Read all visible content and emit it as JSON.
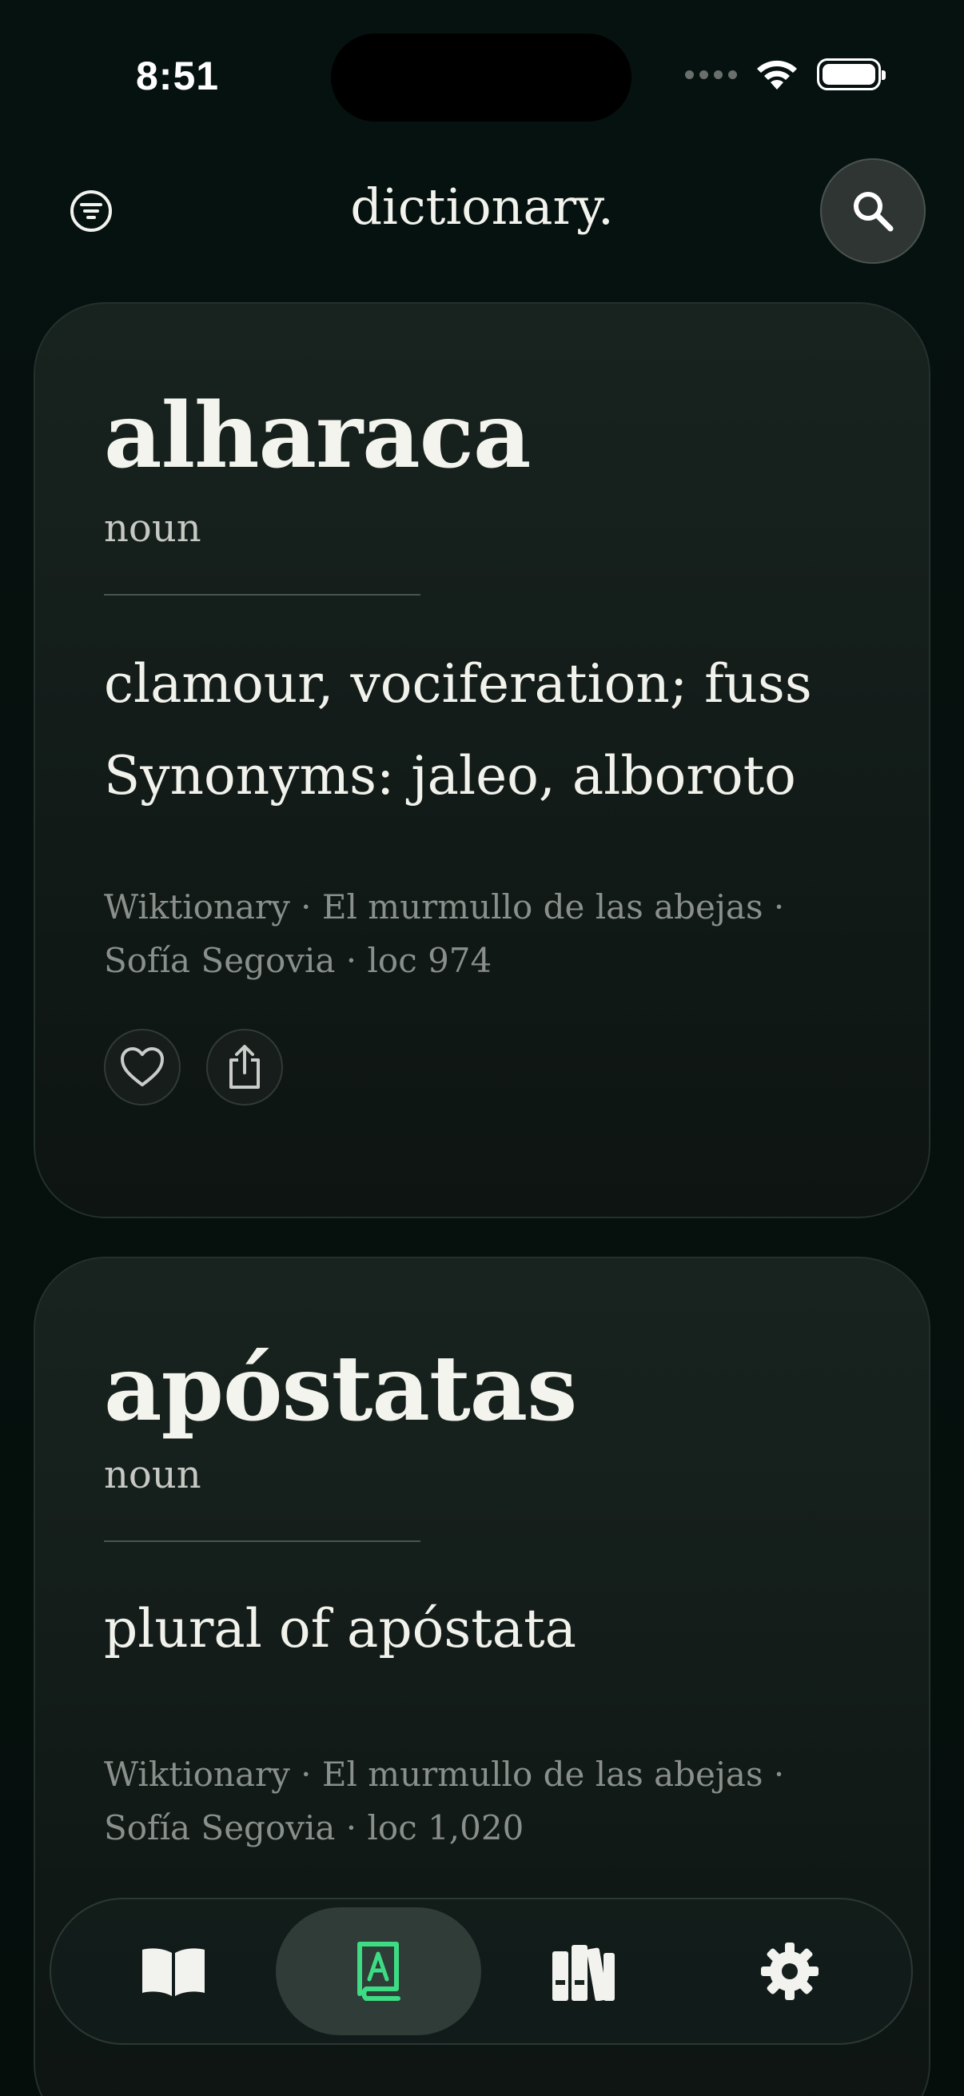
{
  "status_bar": {
    "time": "8:51"
  },
  "header": {
    "title": "dictionary."
  },
  "entries": [
    {
      "word": "alharaca",
      "part_of_speech": "noun",
      "definition": "clamour, vociferation; fuss",
      "synonyms": "Synonyms: jaleo, alboroto",
      "source": "Wiktionary · El murmullo de las abejas · Sofía Segovia · loc 974"
    },
    {
      "word": "apóstatas",
      "part_of_speech": "noun",
      "definition": "plural of apóstata",
      "source": "Wiktionary · El murmullo de las abejas · Sofía Segovia · loc 1,020"
    }
  ],
  "tabbar": {
    "tabs": [
      {
        "icon": "open-book-icon",
        "active": false
      },
      {
        "icon": "dictionary-icon",
        "active": true
      },
      {
        "icon": "library-icon",
        "active": false
      },
      {
        "icon": "gear-icon",
        "active": false
      }
    ],
    "active_color": "#3ddc84"
  },
  "colors": {
    "background": "#06100d",
    "card": "#18231f",
    "text": "#f2f2ee",
    "muted": "#8a8f8b"
  }
}
